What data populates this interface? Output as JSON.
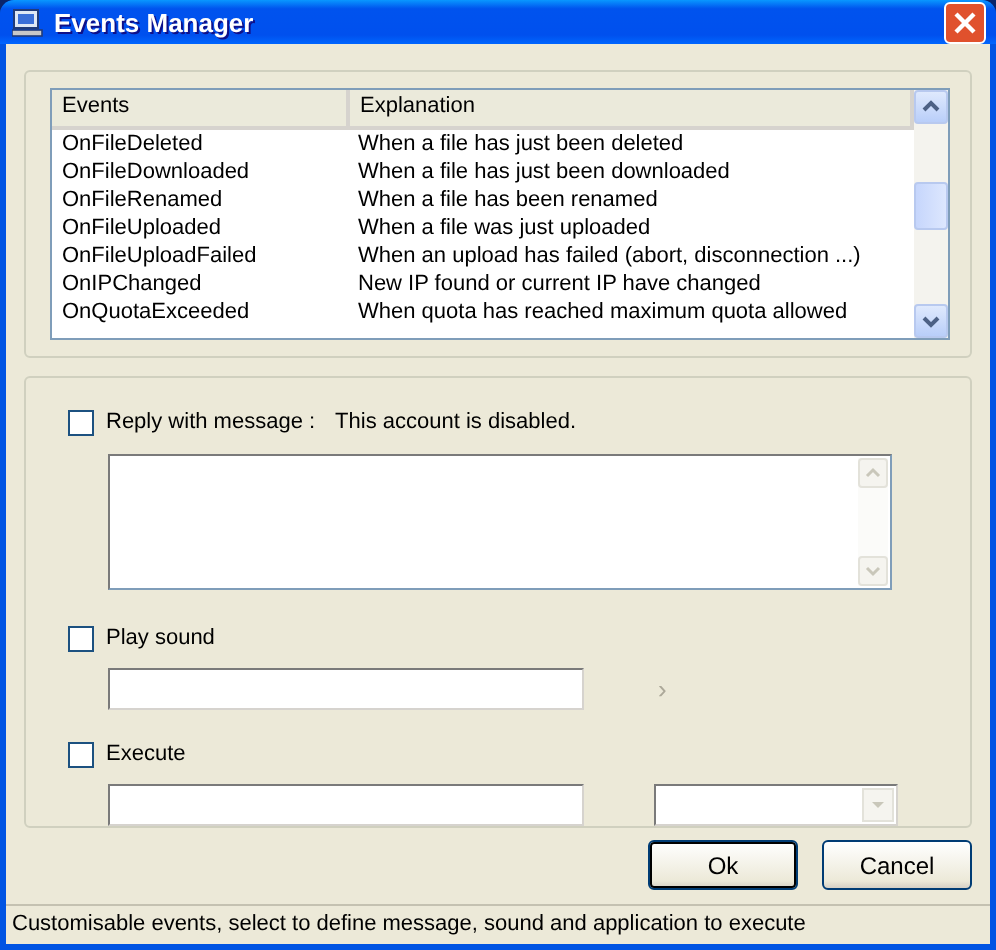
{
  "window": {
    "title": "Events Manager"
  },
  "events_list": {
    "columns": [
      "Events",
      "Explanation"
    ],
    "rows": [
      {
        "event": "OnFileDeleted",
        "explanation": "When a file has just been deleted",
        "selected": false
      },
      {
        "event": "OnFileDownloaded",
        "explanation": "When a file has just been downloaded",
        "selected": false
      },
      {
        "event": "OnFileRenamed",
        "explanation": "When a file has been renamed",
        "selected": false
      },
      {
        "event": "OnFileUploaded",
        "explanation": "When a file was just uploaded",
        "selected": false
      },
      {
        "event": "OnFileUploadFailed",
        "explanation": "When an upload has failed (abort, disconnection ...)",
        "selected": false
      },
      {
        "event": "OnIPChanged",
        "explanation": "New IP found or current IP have changed",
        "selected": false
      },
      {
        "event": "OnQuotaExceeded",
        "explanation": "When quota has reached maximum quota allowed",
        "selected": false
      }
    ]
  },
  "options": [
    {
      "kind": "message",
      "label": "Reply with message :",
      "value": "This account is disabled.",
      "checked": false
    },
    {
      "kind": "sound",
      "label": "Play sound",
      "checked": false,
      "browse": "›"
    },
    {
      "kind": "execute",
      "label": "Execute",
      "checked": false
    }
  ],
  "buttons": [
    {
      "label": "Ok",
      "default": true
    },
    {
      "label": "Cancel",
      "default": false
    }
  ],
  "status_bar": "Customisable events, select to define message, sound and application to execute"
}
